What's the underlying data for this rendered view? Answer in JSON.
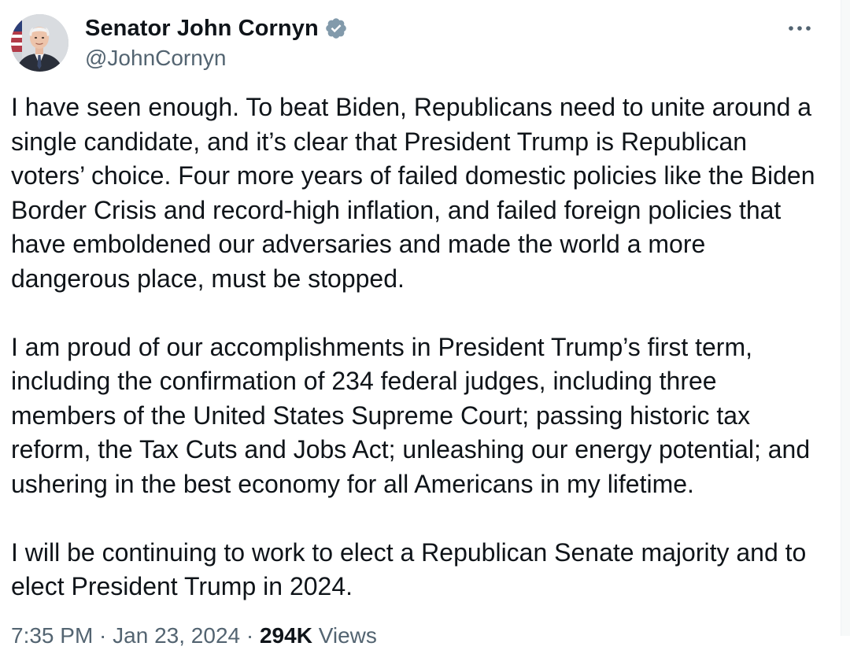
{
  "author": {
    "display_name": "Senator John Cornyn",
    "handle": "@JohnCornyn",
    "verified": true,
    "avatar_icon": "profile-photo-avatar",
    "verified_color": "#829aab"
  },
  "menu": {
    "more_icon": "more-horizontal-icon"
  },
  "tweet": {
    "paragraphs": [
      "I have seen enough. To beat Biden, Republicans need to unite around a\nsingle candidate, and it’s clear that President Trump is Republican\nvoters’ choice. Four more years of failed domestic policies like the Biden\nBorder Crisis and record-high inflation, and failed foreign policies that\nhave emboldened our adversaries and made the world a more\ndangerous place, must be stopped.",
      "I am proud of our accomplishments in President Trump’s first term,\nincluding the confirmation of 234 federal judges, including three\nmembers of the United States Supreme Court; passing historic tax\nreform, the Tax Cuts and Jobs Act; unleashing our energy potential; and\nushering in the best economy for all Americans in my lifetime.",
      "I will be continuing to work to elect a Republican Senate majority and to\nelect President Trump in 2024."
    ]
  },
  "meta": {
    "time": "7:35 PM",
    "separator": " · ",
    "date": "Jan 23, 2024",
    "views_count": "294K",
    "views_label": " Views"
  }
}
